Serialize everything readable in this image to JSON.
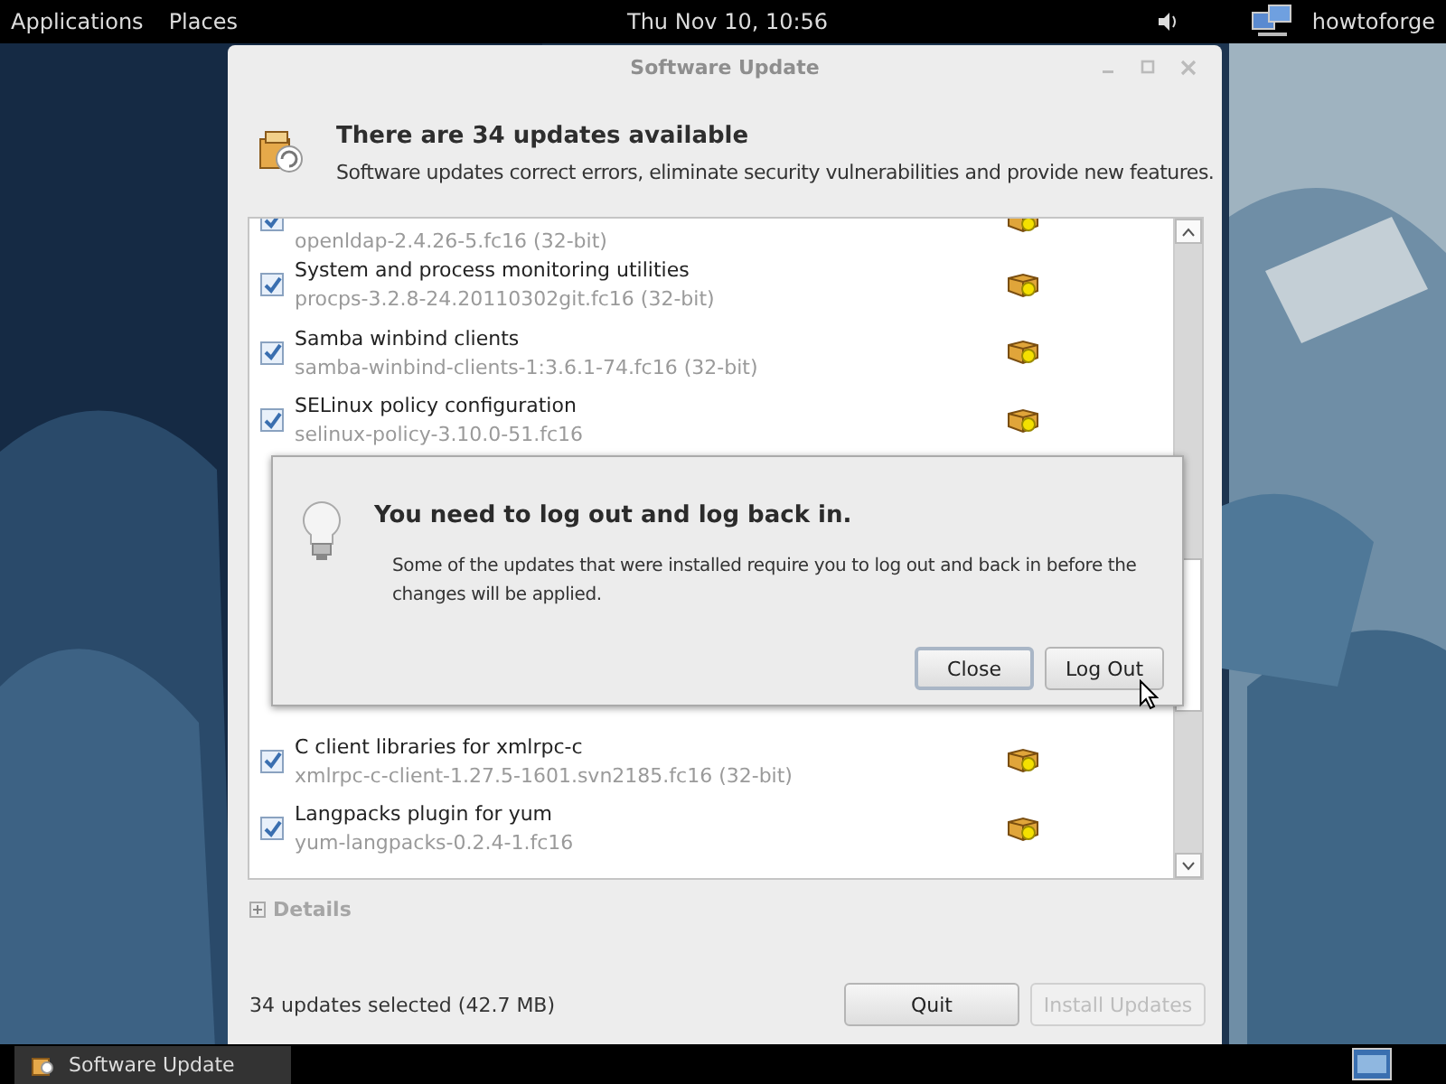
{
  "top_bar": {
    "menus": [
      "Applications",
      "Places"
    ],
    "clock": "Thu Nov 10, 10:56",
    "user": "howtoforge"
  },
  "window": {
    "title": "Software Update"
  },
  "header": {
    "title": "There are 34 updates available",
    "subtitle": "Software updates correct errors, eliminate security vulnerabilities and provide new features."
  },
  "updates": [
    {
      "package": "openldap-2.4.26-5.fc16 (32-bit)",
      "checked": true,
      "partial": true
    },
    {
      "name": "System and process monitoring utilities",
      "package": "procps-3.2.8-24.20110302git.fc16 (32-bit)",
      "checked": true
    },
    {
      "name": "Samba winbind clients",
      "package": "samba-winbind-clients-1:3.6.1-74.fc16 (32-bit)",
      "checked": true
    },
    {
      "name": "SELinux policy configuration",
      "package": "selinux-policy-3.10.0-51.fc16",
      "checked": true
    },
    {
      "name": "C client libraries for xmlrpc-c",
      "package": "xmlrpc-c-client-1.27.5-1601.svn2185.fc16 (32-bit)",
      "checked": true,
      "after_hidden": true
    },
    {
      "name": "Langpacks plugin for yum",
      "package": "yum-langpacks-0.2.4-1.fc16",
      "checked": true
    }
  ],
  "details": {
    "label": "Details",
    "expanded": false
  },
  "status": "34 updates selected (42.7 MB)",
  "buttons": [
    {
      "label": "Quit",
      "disabled": false
    },
    {
      "label": "Install Updates",
      "disabled": true
    }
  ],
  "dialog": {
    "title": "You need to log out and log back in.",
    "message": "Some of the updates that were installed require you to log out and back in before the changes will be applied.",
    "buttons": [
      {
        "label": "Close",
        "default": true
      },
      {
        "label": "Log Out",
        "default": false
      }
    ]
  },
  "taskbar": {
    "items": [
      {
        "label": "Software Update",
        "selected": false
      }
    ]
  }
}
